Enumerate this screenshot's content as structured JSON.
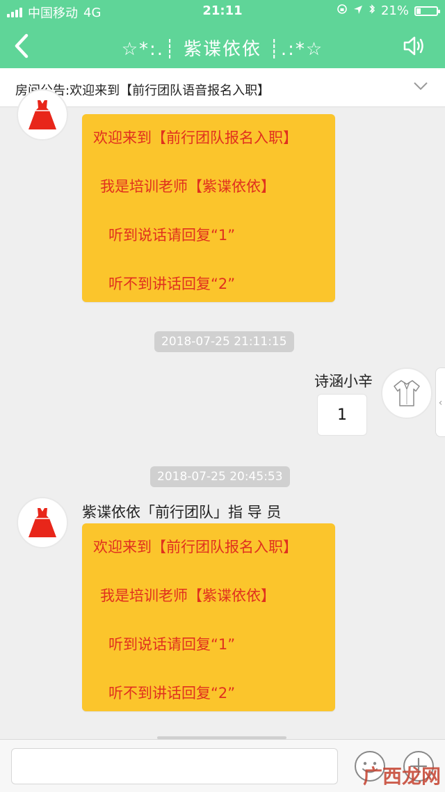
{
  "status_bar": {
    "carrier": "中国移动",
    "network": "4G",
    "time": "21:11",
    "battery": "21%",
    "battery_level": 0.21
  },
  "header": {
    "title": "☆*:.┊ 紫谍依依 ┊.:*☆"
  },
  "notice": {
    "text": "房间公告:欢迎来到【前行团队语音报名入职】"
  },
  "messages": {
    "top_bubble": {
      "lines": [
        "欢迎来到【前行团队报名入职】",
        "我是培训老师【紫谍依依】",
        "听到说话请回复“1”",
        "听不到讲话回复“2”"
      ]
    },
    "timestamp_1": "2018-07-25 21:11:15",
    "mine": {
      "sender": "诗涵小辛",
      "text": "1"
    },
    "timestamp_2": "2018-07-25 20:45:53",
    "bottom": {
      "sender": "紫谍依依「前行团队」指 导 员",
      "lines": [
        "欢迎来到【前行团队报名入职】",
        "我是培训老师【紫谍依依】",
        "听到说话请回复“1”",
        "听不到讲话回复“2”"
      ]
    }
  },
  "input": {
    "placeholder": ""
  },
  "icons": {
    "back": "back-chevron-icon",
    "speaker": "speaker-icon",
    "chevron": "chevron-down-icon",
    "emoji": "emoji-icon",
    "plus": "plus-icon",
    "dress_avatar": "red-dress-icon",
    "shirt_avatar": "white-shirt-icon"
  },
  "watermark": "广西龙网",
  "colors": {
    "brand_green": "#5fd598",
    "bubble_yellow": "#fbc52c",
    "bubble_text_red": "#e0301e"
  }
}
